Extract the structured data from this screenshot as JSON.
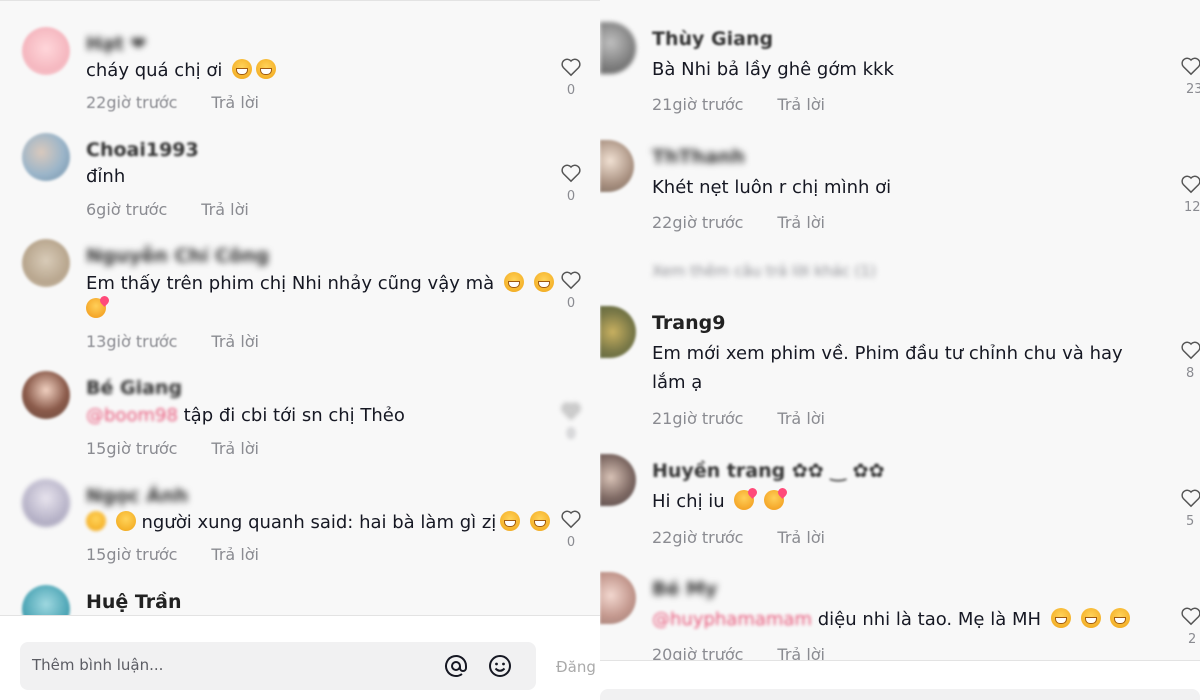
{
  "left": {
    "comments": [
      {
        "username": "Hạt ❤",
        "text": "cháy quá chị ơi",
        "time": "22giờ trước",
        "reply": "Trả lời",
        "likes": "0"
      },
      {
        "username": "Choai1993",
        "text": "đỉnh",
        "time": "6giờ trước",
        "reply": "Trả lời",
        "likes": "0"
      },
      {
        "username": "Nguyễn Chí Công",
        "text": "Em thấy trên phim chị Nhi nhảy cũng vậy mà",
        "time": "13giờ trước",
        "reply": "Trả lời",
        "likes": "0"
      },
      {
        "username": "Bé Giang",
        "mention": "@boom98",
        "text": " tập đi cbi tới sn chị Thẻo",
        "time": "15giờ trước",
        "reply": "Trả lời",
        "likes": "0"
      },
      {
        "username": "Ngọc Ánh",
        "text": "người xung quanh said: hai bà làm gì zị",
        "time": "15giờ trước",
        "reply": "Trả lời",
        "likes": "0"
      },
      {
        "username": "Huệ Trần"
      }
    ],
    "input": {
      "placeholder": "Thêm bình luận...",
      "post": "Đăng"
    }
  },
  "right": {
    "comments": [
      {
        "username": "Thùy Giang",
        "text": "Bà Nhi bả lầy ghê gớm kkk",
        "time": "21giờ trước",
        "reply": "Trả lời",
        "likes": "23"
      },
      {
        "username": "ThThanh",
        "text": "Khét nẹt luôn r chị mình ơi",
        "time": "22giờ trước",
        "reply": "Trả lời",
        "likes": "12"
      },
      {
        "username": "Trang9",
        "text": "Em mới xem phim về. Phim đầu tư chỉnh chu và hay",
        "text2": "lắm ạ",
        "time": "21giờ trước",
        "reply": "Trả lời",
        "likes": "8"
      },
      {
        "username": "Huyền trang ✿✿ ‿ ✿✿",
        "text": "Hi chị iu",
        "time": "22giờ trước",
        "reply": "Trả lời",
        "likes": "5"
      },
      {
        "username": "Bé My",
        "mention": "@huyphamamam",
        "text": " diệu nhi là tao. Mẹ là MH",
        "time": "20giờ trước",
        "reply": "Trả lời",
        "likes": "2"
      }
    ],
    "more_replies": "Xem thêm câu trả lời khác (1)"
  },
  "colors": {
    "background": "#f8f8f8",
    "text": "#161823",
    "meta": "#8a8b91",
    "mention": "#e8577a"
  }
}
